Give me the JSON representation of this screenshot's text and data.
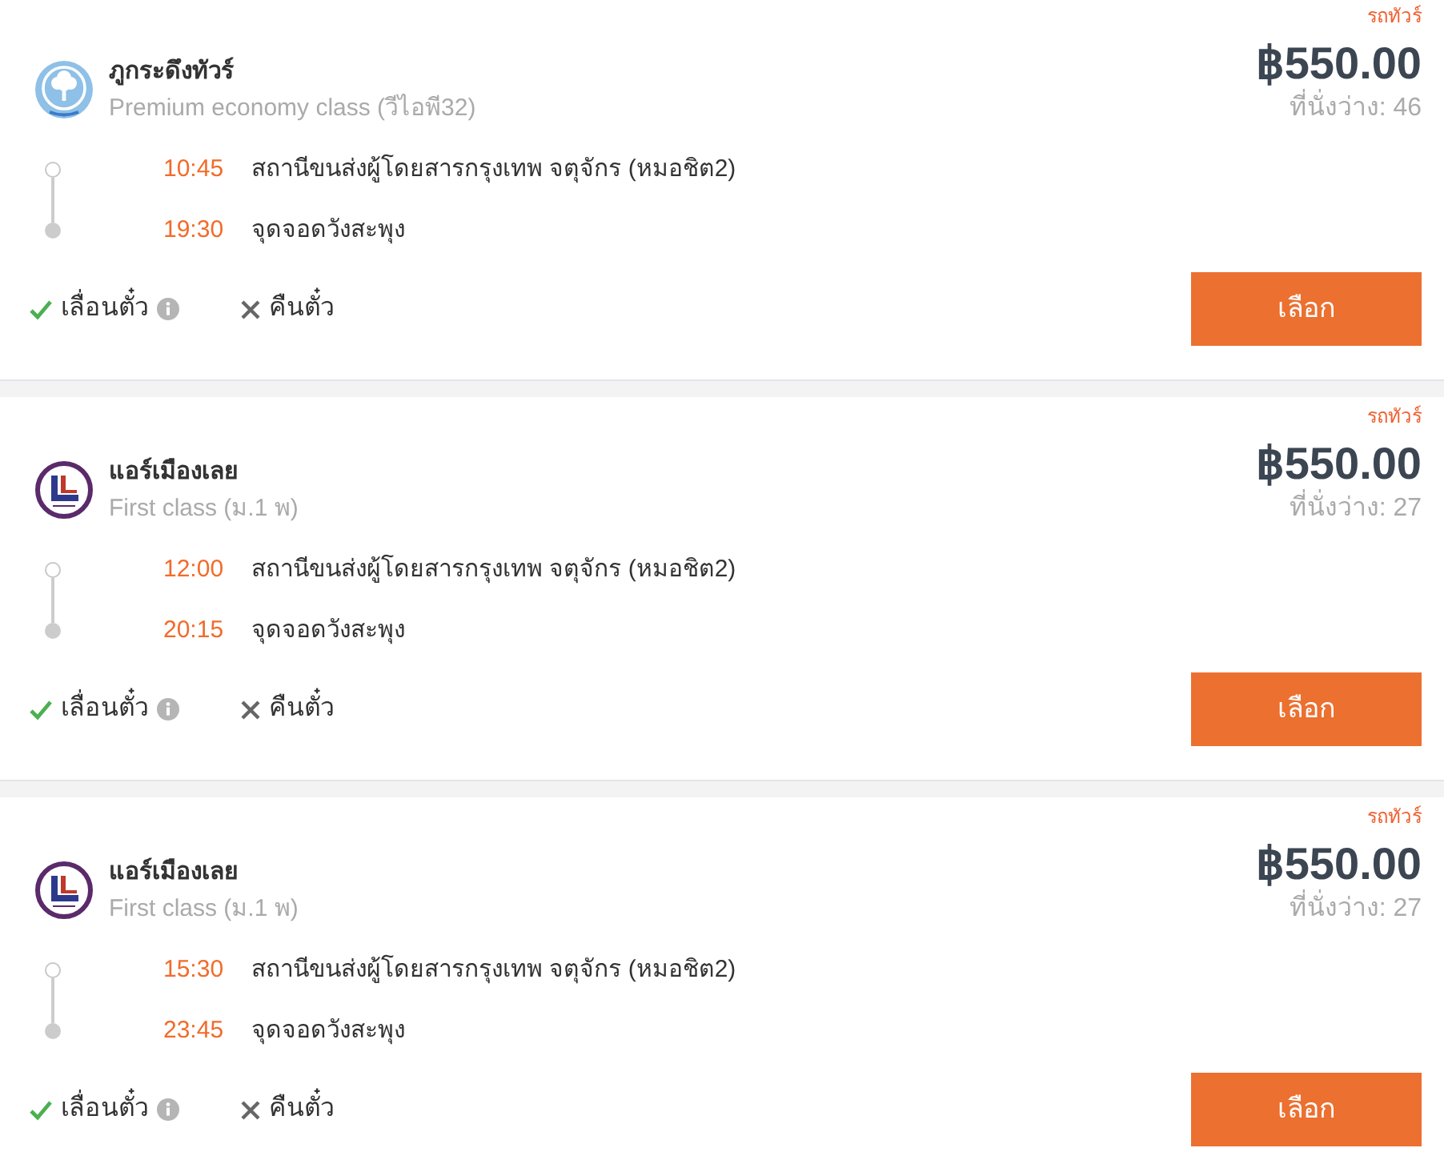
{
  "trips": [
    {
      "tag": "รถทัวร์",
      "price": "฿550.00",
      "seats": "ที่นั่งว่าง: 46",
      "operator": {
        "name": "ภูกระดึงทัวร์",
        "seat_class": "Premium economy class (วีไอพี32)",
        "logo": {
          "kind": "tree"
        }
      },
      "stops": [
        {
          "kind": "departure",
          "time": "10:45",
          "place": "สถานีขนส่งผู้โดยสารกรุงเทพ จตุจักร (หมอชิต2)"
        },
        {
          "kind": "arrival",
          "time": "19:30",
          "place": "จุดจอดวังสะพุง"
        }
      ],
      "features": [
        {
          "label": "เลื่อนตั๋ว",
          "available": true,
          "info": true
        },
        {
          "label": "คืนตั๋ว",
          "available": false,
          "info": false
        }
      ],
      "button": "เลือก"
    },
    {
      "tag": "รถทัวร์",
      "price": "฿550.00",
      "seats": "ที่นั่งว่าง: 27",
      "operator": {
        "name": "แอร์เมืองเลย",
        "seat_class": "First class (ม.1 พ)",
        "logo": {
          "kind": "letter"
        }
      },
      "stops": [
        {
          "kind": "departure",
          "time": "12:00",
          "place": "สถานีขนส่งผู้โดยสารกรุงเทพ จตุจักร (หมอชิต2)"
        },
        {
          "kind": "arrival",
          "time": "20:15",
          "place": "จุดจอดวังสะพุง"
        }
      ],
      "features": [
        {
          "label": "เลื่อนตั๋ว",
          "available": true,
          "info": true
        },
        {
          "label": "คืนตั๋ว",
          "available": false,
          "info": false
        }
      ],
      "button": "เลือก"
    },
    {
      "tag": "รถทัวร์",
      "price": "฿550.00",
      "seats": "ที่นั่งว่าง: 27",
      "operator": {
        "name": "แอร์เมืองเลย",
        "seat_class": "First class (ม.1 พ)",
        "logo": {
          "kind": "letter"
        }
      },
      "stops": [
        {
          "kind": "departure",
          "time": "15:30",
          "place": "สถานีขนส่งผู้โดยสารกรุงเทพ จตุจักร (หมอชิต2)"
        },
        {
          "kind": "arrival",
          "time": "23:45",
          "place": "จุดจอดวังสะพุง"
        }
      ],
      "features": [
        {
          "label": "เลื่อนตั๋ว",
          "available": true,
          "info": true
        },
        {
          "label": "คืนตั๋ว",
          "available": false,
          "info": false
        }
      ],
      "button": "เลือก"
    }
  ]
}
